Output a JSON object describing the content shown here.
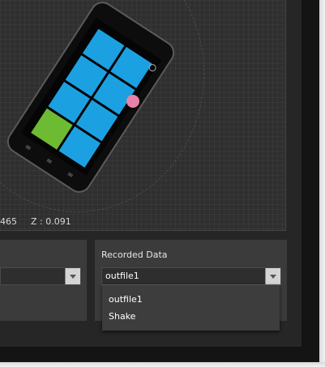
{
  "accelerometer": {
    "y_partial": "465",
    "z_readout": "Z : 0.091"
  },
  "phone": {
    "start_label": "◉",
    "tile_colors": {
      "primary": "#1ba1e2",
      "highlight": "#6cbb32"
    },
    "touch_marker_color": "#e882a8"
  },
  "left_panel": {
    "selected_value": ""
  },
  "recorded_data": {
    "title": "Recorded Data",
    "selected_value": "outfile1",
    "options": [
      "outfile1",
      "Shake"
    ]
  },
  "colors": {
    "background": "#141414",
    "panel": "#3b3b3b",
    "accent_tile": "#1ba1e2"
  }
}
